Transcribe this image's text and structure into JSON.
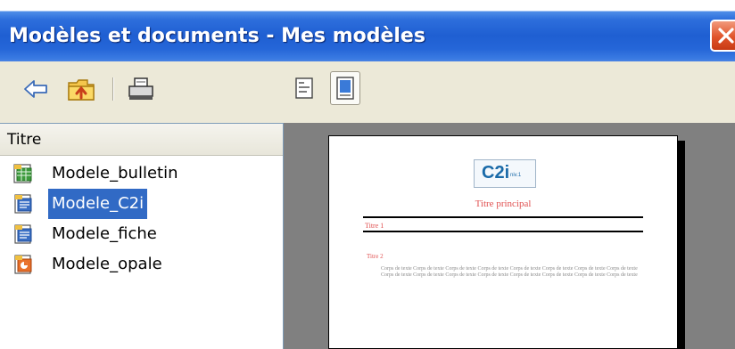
{
  "window": {
    "title": "Modèles et documents - Mes modèles"
  },
  "toolbar": {
    "buttons": [
      {
        "icon": "back-arrow-icon"
      },
      {
        "icon": "folder-up-icon"
      },
      {
        "icon": "print-icon"
      }
    ],
    "views": [
      {
        "icon": "document-properties-icon",
        "active": false
      },
      {
        "icon": "preview-icon",
        "active": true
      }
    ]
  },
  "list": {
    "column_header": "Titre",
    "items": [
      {
        "label": "Modele_bulletin",
        "selected": false,
        "icon": "spreadsheet-template-icon"
      },
      {
        "label": "Modele_C2i",
        "selected": true,
        "icon": "text-template-icon"
      },
      {
        "label": "Modele_fiche",
        "selected": false,
        "icon": "text-template-icon"
      },
      {
        "label": "Modele_opale",
        "selected": false,
        "icon": "presentation-template-icon"
      }
    ]
  },
  "preview": {
    "logo_text": "C2i",
    "logo_small": "niv.1",
    "title": "Titre principal",
    "heading1": "Titre 1",
    "heading2": "Titre 2",
    "body": "Corps de texte Corps de texte Corps de texte Corps de texte Corps de texte Corps de texte Corps de texte Corps de texte Corps de texte Corps de texte Corps de texte Corps de texte Corps de texte Corps de texte Corps de texte Corps de texte"
  },
  "colors": {
    "title_bar": "#2566d8",
    "selection": "#316ac5",
    "accent_red": "#e05050",
    "close_button": "#e0532a"
  }
}
